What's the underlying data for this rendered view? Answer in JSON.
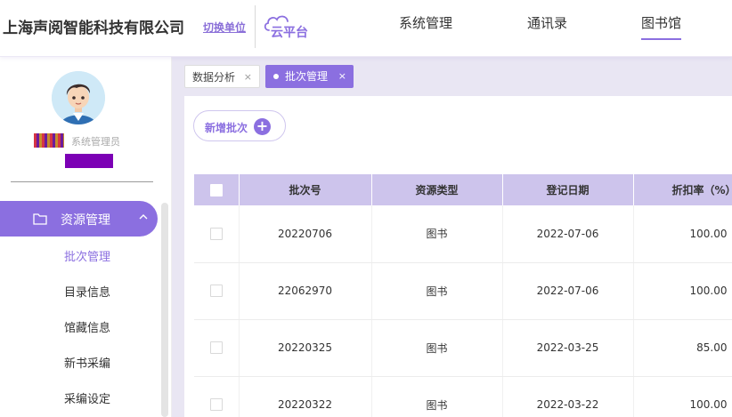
{
  "header": {
    "company": "上海声阅智能科技有限公司",
    "switch_unit": "切换单位",
    "platform": "云平台",
    "nav": [
      "系统管理",
      "通讯录",
      "图书馆"
    ],
    "active_nav": "图书馆"
  },
  "user": {
    "role": "系统管理员"
  },
  "sidebar": {
    "group_label": "资源管理",
    "group_icon": "folder-icon",
    "items": [
      "批次管理",
      "目录信息",
      "馆藏信息",
      "新书采编",
      "采编设定"
    ],
    "active_item": "批次管理"
  },
  "tabs": [
    {
      "label": "数据分析",
      "close": "×",
      "active": false
    },
    {
      "label": "批次管理",
      "close": "×",
      "active": true
    }
  ],
  "toolbar": {
    "add_batch": "新增批次",
    "add_icon": "plus-icon"
  },
  "table": {
    "columns": [
      "批次号",
      "资源类型",
      "登记日期",
      "折扣率（%）"
    ],
    "rows": [
      {
        "batch": "20220706",
        "type": "图书",
        "date": "2022-07-06",
        "rate": "100.00"
      },
      {
        "batch": "22062970",
        "type": "图书",
        "date": "2022-07-06",
        "rate": "100.00"
      },
      {
        "batch": "20220325",
        "type": "图书",
        "date": "2022-03-25",
        "rate": "85.00"
      },
      {
        "batch": "20220322",
        "type": "图书",
        "date": "2022-03-22",
        "rate": "100.00"
      }
    ]
  },
  "colors": {
    "accent": "#8b6fe0",
    "table_header": "#cdc4ec",
    "tab_bar": "#e9e6f3",
    "redaction_purple": "#7c00b5"
  }
}
